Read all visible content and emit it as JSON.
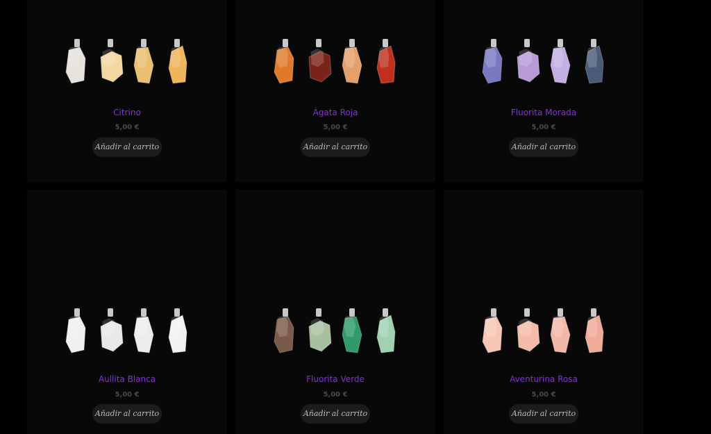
{
  "products": [
    {
      "name": "Citrino",
      "price": "5,00 €",
      "button": "Añadir al carrito",
      "stones": [
        "#e6e2dc",
        "#f3d7a0",
        "#e8c070",
        "#f0b45a"
      ]
    },
    {
      "name": "Ágata Roja",
      "price": "5,00 €",
      "button": "Añadir al carrito",
      "stones": [
        "#e07a2a",
        "#7a2418",
        "#e6a06a",
        "#c0301c"
      ]
    },
    {
      "name": "Fluorita Morada",
      "price": "5,00 €",
      "button": "Añadir al carrito",
      "stones": [
        "#7a78c0",
        "#b89ad8",
        "#c4aee6",
        "#4a5a78"
      ]
    },
    {
      "name": "Aullita Blanca",
      "price": "5,00 €",
      "button": "Añadir al carrito",
      "stones": [
        "#f0f0f0",
        "#e8e8e8",
        "#ececec",
        "#f2f2f2"
      ]
    },
    {
      "name": "Fluorita Verde",
      "price": "5,00 €",
      "button": "Añadir al carrito",
      "stones": [
        "#7a5a48",
        "#a8c0a0",
        "#2f9a6a",
        "#9ed2b0"
      ]
    },
    {
      "name": "Aventurina Rosa",
      "price": "5,00 €",
      "button": "Añadir al carrito",
      "stones": [
        "#f6c6b4",
        "#f4bca8",
        "#f2b8a6",
        "#f0aa98"
      ]
    }
  ]
}
